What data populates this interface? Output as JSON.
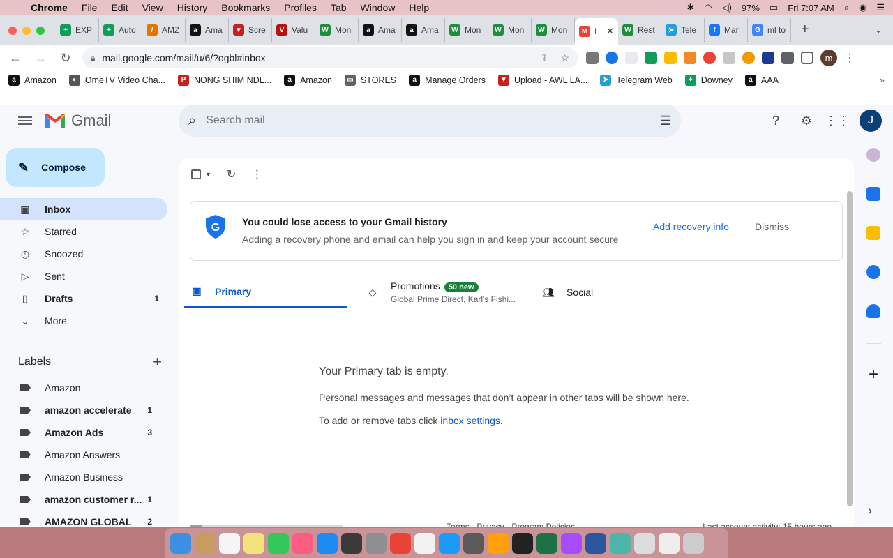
{
  "menubar": {
    "app": "Chrome",
    "items": [
      "File",
      "Edit",
      "View",
      "History",
      "Bookmarks",
      "Profiles",
      "Tab",
      "Window",
      "Help"
    ],
    "battery": "97%",
    "clock": "Fri 7:07 AM"
  },
  "tabs": [
    {
      "label": "EXP",
      "color": "#0f9d58",
      "glyph": "+"
    },
    {
      "label": "Auto",
      "color": "#0f9d58",
      "glyph": "+"
    },
    {
      "label": "AMZ",
      "color": "#e37400",
      "glyph": "/"
    },
    {
      "label": "Ama",
      "color": "#111111",
      "glyph": "a"
    },
    {
      "label": "Scre",
      "color": "#c5221f",
      "glyph": "▼"
    },
    {
      "label": "Valu",
      "color": "#b31412",
      "glyph": "V"
    },
    {
      "label": "Mon",
      "color": "#1e8e3e",
      "glyph": "W"
    },
    {
      "label": "Ama",
      "color": "#111111",
      "glyph": "a"
    },
    {
      "label": "Ama",
      "color": "#111111",
      "glyph": "a"
    },
    {
      "label": "Mon",
      "color": "#1e8e3e",
      "glyph": "W"
    },
    {
      "label": "Mon",
      "color": "#1e8e3e",
      "glyph": "W"
    },
    {
      "label": "Mon",
      "color": "#1e8e3e",
      "glyph": "W"
    },
    {
      "label": "I",
      "color": "#ea4335",
      "glyph": "M",
      "active": true
    },
    {
      "label": "Rest",
      "color": "#1e8e3e",
      "glyph": "W"
    },
    {
      "label": "Tele",
      "color": "#229ed9",
      "glyph": "➤"
    },
    {
      "label": "Mar",
      "color": "#1877f2",
      "glyph": "f"
    },
    {
      "label": "ml to",
      "color": "#4285f4",
      "glyph": "G"
    }
  ],
  "omnibox": {
    "url": "mail.google.com/mail/u/6/?ogbl#inbox"
  },
  "profile_initial": "m",
  "bookmarks": [
    {
      "label": "Amazon",
      "color": "#111111",
      "glyph": "a"
    },
    {
      "label": "OmeTV Video Cha...",
      "color": "#555555",
      "glyph": "◐"
    },
    {
      "label": "NONG SHIM NDL...",
      "color": "#c5221f",
      "glyph": "P"
    },
    {
      "label": "Amazon",
      "color": "#111111",
      "glyph": "a"
    },
    {
      "label": "STORES",
      "color": "#5f6368",
      "glyph": "▭"
    },
    {
      "label": "Manage Orders",
      "color": "#111111",
      "glyph": "a"
    },
    {
      "label": "Upload - AWL LA...",
      "color": "#c5221f",
      "glyph": "▼"
    },
    {
      "label": "Telegram Web",
      "color": "#229ed9",
      "glyph": "➤"
    },
    {
      "label": "Downey",
      "color": "#0f9d58",
      "glyph": "+"
    },
    {
      "label": "AAA",
      "color": "#111111",
      "glyph": "a"
    }
  ],
  "gmail": {
    "brand": "Gmail",
    "search_placeholder": "Search mail",
    "account_initial": "J",
    "compose": "Compose",
    "nav": [
      {
        "label": "Inbox",
        "icon": "inbox-icon",
        "glyph": "▣",
        "active": true,
        "count": ""
      },
      {
        "label": "Starred",
        "icon": "star-icon",
        "glyph": "☆",
        "count": ""
      },
      {
        "label": "Snoozed",
        "icon": "clock-icon",
        "glyph": "◷",
        "count": ""
      },
      {
        "label": "Sent",
        "icon": "send-icon",
        "glyph": "▷",
        "count": ""
      },
      {
        "label": "Drafts",
        "icon": "draft-icon",
        "glyph": "▯",
        "bold": true,
        "count": "1"
      },
      {
        "label": "More",
        "icon": "chevron-down-icon",
        "glyph": "⌄",
        "count": ""
      }
    ],
    "labels_title": "Labels",
    "labels": [
      {
        "label": "Amazon",
        "count": "",
        "bold": false
      },
      {
        "label": "amazon accelerate",
        "count": "1",
        "bold": true
      },
      {
        "label": "Amazon Ads",
        "count": "3",
        "bold": true
      },
      {
        "label": "Amazon Answers",
        "count": "",
        "bold": false
      },
      {
        "label": "Amazon Business",
        "count": "",
        "bold": false
      },
      {
        "label": "amazon customer r...",
        "count": "1",
        "bold": true
      },
      {
        "label": "AMAZON GLOBAL",
        "count": "2",
        "bold": true
      }
    ],
    "banner": {
      "title": "You could lose access to your Gmail history",
      "subtitle": "Adding a recovery phone and email can help you sign in and keep your account secure",
      "action": "Add recovery info",
      "dismiss": "Dismiss"
    },
    "tabs": {
      "primary": "Primary",
      "promotions": "Promotions",
      "promotions_badge": "50 new",
      "promotions_sub": "Global Prime Direct, Karl's Fishi...",
      "social": "Social"
    },
    "empty": {
      "title": "Your Primary tab is empty.",
      "body": "Personal messages and messages that don’t appear in other tabs will be shown here.",
      "settings_prefix": "To add or remove tabs click ",
      "settings_link": "inbox settings",
      "settings_suffix": "."
    },
    "footer": "Terms · Privacy · Program Policies",
    "last_activity": "Last account activity: 15 hours ago"
  },
  "dock_colors": [
    "#3d8fe0",
    "#c89b63",
    "#f5f5f5",
    "#f6e27a",
    "#34c759",
    "#fc5c7d",
    "#1c8cf2",
    "#3a3a3a",
    "#8e8e93",
    "#ea4335",
    "#f2f2f2",
    "#1b9af7",
    "#5a5a5a",
    "#ff9f0a",
    "#222222",
    "#1e7145",
    "#a84bff",
    "#2b579a",
    "#4db6ac",
    "#dddddd",
    "#eeeeee",
    "#cccccc"
  ]
}
